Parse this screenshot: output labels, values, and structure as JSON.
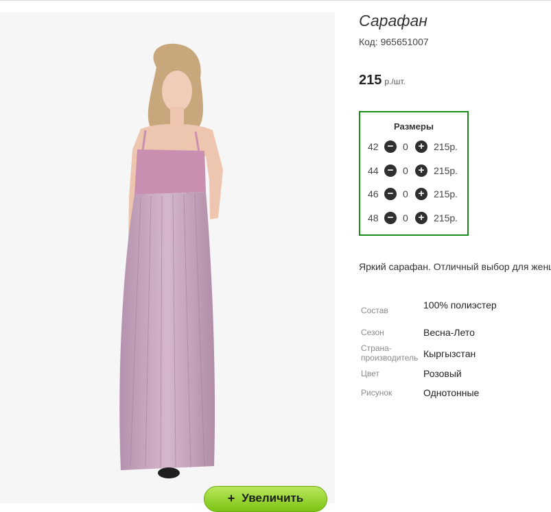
{
  "product": {
    "title": "Сарафан",
    "code_label": "Код:",
    "code_value": "965651007",
    "price_value": "215",
    "price_unit": "р./шт."
  },
  "sizes": {
    "title": "Размеры",
    "rows": [
      {
        "size": "42",
        "qty": "0",
        "price": "215р."
      },
      {
        "size": "44",
        "qty": "0",
        "price": "215р."
      },
      {
        "size": "46",
        "qty": "0",
        "price": "215р."
      },
      {
        "size": "48",
        "qty": "0",
        "price": "215р."
      }
    ]
  },
  "description": "Яркий сарафан. Отличный выбор для женщин",
  "properties": [
    {
      "label": "Состав",
      "value": "100% полиэстер"
    },
    {
      "label": "Сезон",
      "value": "Весна-Лето"
    },
    {
      "label": "Страна-производитель",
      "value": "Кыргызстан"
    },
    {
      "label": "Цвет",
      "value": "Розовый"
    },
    {
      "label": "Рисунок",
      "value": "Однотонные"
    }
  ],
  "zoom_button": {
    "icon": "plus-icon",
    "label": "Увеличить"
  },
  "colors": {
    "accent_green": "#188a18",
    "button_green": "#7cc414",
    "dress": "#c9a3bd"
  }
}
